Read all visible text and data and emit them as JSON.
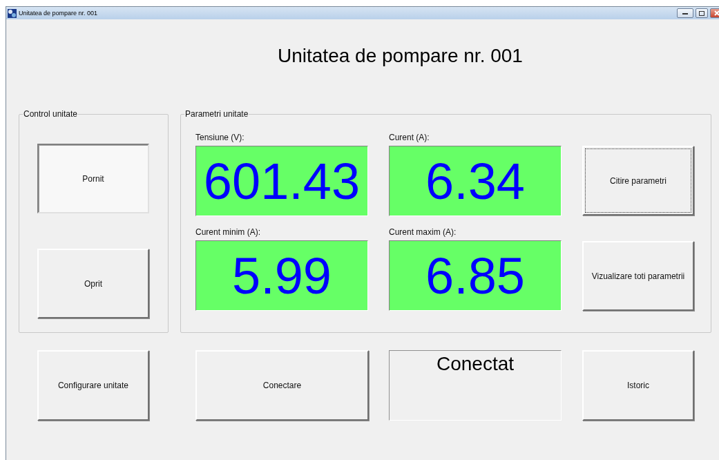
{
  "window": {
    "title": "Unitatea de pompare nr. 001"
  },
  "heading": "Unitatea de pompare nr. 001",
  "control_group": {
    "title": "Control unitate",
    "buttons": [
      {
        "label": "Pornit",
        "pressed": true,
        "focused": false
      },
      {
        "label": "Oprit",
        "pressed": false,
        "focused": false
      }
    ]
  },
  "parameters_group": {
    "title": "Parametri unitate",
    "readings": [
      {
        "label": "Tensiune (V):",
        "value": "601.43"
      },
      {
        "label": "Curent (A):",
        "value": "6.34"
      },
      {
        "label": "Curent minim (A):",
        "value": "5.99"
      },
      {
        "label": "Curent maxim (A):",
        "value": "6.85"
      }
    ],
    "buttons": [
      {
        "label": "Citire parametri",
        "pressed": false,
        "focused": true
      },
      {
        "label": "Vizualizare toti parametrii",
        "pressed": false,
        "focused": false
      }
    ]
  },
  "bottom": {
    "configure_button": {
      "label": "Configurare unitate",
      "pressed": false,
      "focused": false
    },
    "connect_button": {
      "label": "Conectare",
      "pressed": false,
      "focused": false
    },
    "status": "Conectat",
    "history_button": {
      "label": "Istoric",
      "pressed": false,
      "focused": false
    }
  }
}
